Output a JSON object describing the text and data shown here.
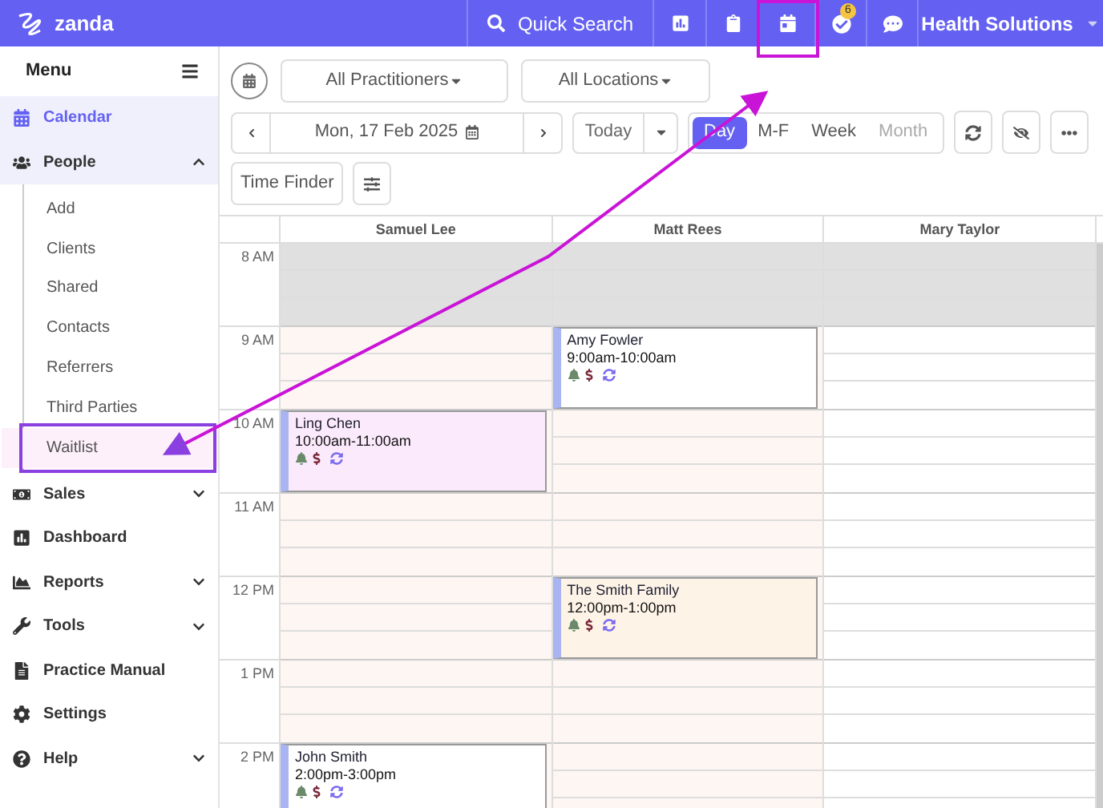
{
  "header": {
    "logo": "zanda",
    "search": "Quick Search",
    "notifications": "6",
    "account": "Health Solutions"
  },
  "sidebar": {
    "title": "Menu",
    "items": [
      {
        "label": "Calendar",
        "selected": true
      },
      {
        "label": "People",
        "selected": false,
        "expanded": true,
        "children": [
          {
            "label": "Add",
            "selected": false
          },
          {
            "label": "Clients",
            "selected": false
          },
          {
            "label": "Shared",
            "selected": false
          },
          {
            "label": "Contacts",
            "selected": false
          },
          {
            "label": "Referrers",
            "selected": false
          },
          {
            "label": "Third Parties",
            "selected": false
          },
          {
            "label": "Waitlist",
            "selected": true
          }
        ]
      },
      {
        "label": "Sales",
        "selected": false,
        "expanded": false
      },
      {
        "label": "Dashboard",
        "selected": false
      },
      {
        "label": "Reports",
        "selected": false,
        "expanded": false
      },
      {
        "label": "Tools",
        "selected": false,
        "expanded": false
      },
      {
        "label": "Practice Manual",
        "selected": false
      },
      {
        "label": "Settings",
        "selected": false
      },
      {
        "label": "Help",
        "selected": false,
        "expanded": false
      }
    ]
  },
  "toolbar": {
    "practitioners": "All Practitioners",
    "locations": "All Locations",
    "date": "Mon, 17 Feb 2025",
    "today": "Today",
    "views": [
      {
        "label": "Day",
        "selected": true,
        "disabled": false
      },
      {
        "label": "M-F",
        "selected": false,
        "disabled": false
      },
      {
        "label": "Week",
        "selected": false,
        "disabled": false
      },
      {
        "label": "Month",
        "selected": false,
        "disabled": true
      }
    ],
    "time_finder": "Time Finder"
  },
  "calendar": {
    "hours": [
      {
        "label": "8 AM",
        "closed": true
      },
      {
        "label": "9 AM",
        "closed": false
      },
      {
        "label": "10 AM",
        "closed": false
      },
      {
        "label": "11 AM",
        "closed": false
      },
      {
        "label": "12 PM",
        "closed": false
      },
      {
        "label": "1 PM",
        "closed": false
      },
      {
        "label": "2 PM",
        "closed": false
      }
    ],
    "columns": [
      {
        "name": "Samuel Lee",
        "working": true,
        "slots": [
          {
            "booked": false
          },
          {
            "booked": false
          },
          {
            "booked": true,
            "name": "Ling Chen",
            "time": "10:00am-11:00am",
            "color": "#fbeafb"
          },
          {
            "booked": false
          },
          {
            "booked": false
          },
          {
            "booked": false
          },
          {
            "booked": true,
            "name": "John Smith",
            "time": "2:00pm-3:00pm",
            "color": "#ffffff"
          }
        ]
      },
      {
        "name": "Matt Rees",
        "working": true,
        "slots": [
          {
            "booked": false
          },
          {
            "booked": true,
            "name": "Amy Fowler",
            "time": "9:00am-10:00am",
            "color": "#ffffff"
          },
          {
            "booked": false
          },
          {
            "booked": false
          },
          {
            "booked": true,
            "name": "The Smith Family",
            "time": "12:00pm-1:00pm",
            "color": "#fdf3e7"
          },
          {
            "booked": false
          },
          {
            "booked": false
          }
        ]
      },
      {
        "name": "Mary Taylor",
        "working": false,
        "slots": [
          {
            "booked": false
          },
          {
            "booked": false
          },
          {
            "booked": false
          },
          {
            "booked": false
          },
          {
            "booked": false
          },
          {
            "booked": false
          },
          {
            "booked": false
          }
        ]
      }
    ]
  }
}
